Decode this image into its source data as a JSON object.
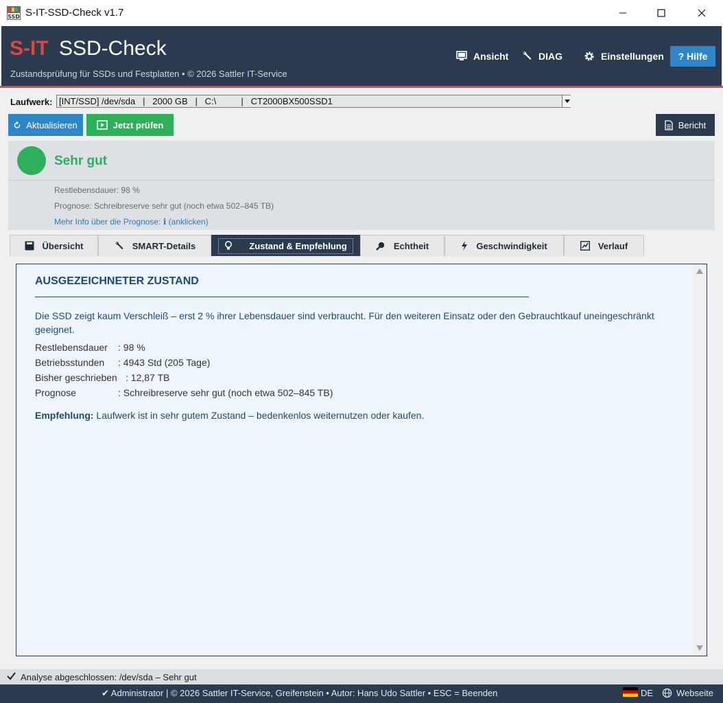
{
  "window": {
    "title": "S-IT-SSD-Check  v1.7"
  },
  "header": {
    "brand_prefix": "S-IT",
    "brand_name": "SSD-Check",
    "subtitle": "Zustandsprüfung für SSDs und Festplatten  •  © 2026 Sattler IT-Service",
    "buttons": {
      "ansicht": "Ansicht",
      "diag": "DIAG",
      "einstellungen": "Einstellungen",
      "hilfe": "? Hilfe"
    }
  },
  "drive": {
    "label": "Laufwerk:",
    "selected": "[INT/SSD] /dev/sda   |   2000 GB   |   C:\\          |   CT2000BX500SSD1"
  },
  "toolbar": {
    "aktualisieren": "Aktualisieren",
    "jetzt_pruefen": "Jetzt prüfen",
    "bericht": "Bericht"
  },
  "status": {
    "label": "Sehr gut",
    "color": "#2eaf5a",
    "restlebensdauer": "Restlebensdauer: 98 %",
    "prognose": "Prognose: Schreibreserve sehr gut  (noch etwa 502–845 TB)",
    "info_link": "Mehr Info über die Prognose:  ℹ  (anklicken)"
  },
  "tabs": [
    {
      "label": "Übersicht",
      "icon": "drive-icon"
    },
    {
      "label": "SMART-Details",
      "icon": "wrench-icon"
    },
    {
      "label": "Zustand & Empfehlung",
      "icon": "lightbulb-icon",
      "active": true
    },
    {
      "label": "Echtheit",
      "icon": "magnifier-icon"
    },
    {
      "label": "Geschwindigkeit",
      "icon": "lightning-icon"
    },
    {
      "label": "Verlauf",
      "icon": "chart-icon"
    }
  ],
  "content": {
    "heading": "AUSGEZEICHNETER ZUSTAND",
    "description": "Die SSD zeigt kaum Verschleiß – erst 2 % ihrer Lebensdauer sind verbraucht. Für den weiteren Einsatz oder den Gebrauchtkauf uneingeschränkt geeignet.",
    "details": [
      {
        "key": "Restlebensdauer",
        "value": ": 98 %"
      },
      {
        "key": "Betriebsstunden",
        "value": ": 4943 Std (205 Tage)"
      },
      {
        "key": "Bisher geschrieben",
        "value": ": 12,87 TB"
      },
      {
        "key": "Prognose",
        "value": ": Schreibreserve sehr gut  (noch etwa 502–845 TB)"
      }
    ],
    "empfehlung_label": "Empfehlung:",
    "empfehlung_text": " Laufwerk ist in sehr gutem Zustand – bedenkenlos weiternutzen oder kaufen."
  },
  "statusbar": {
    "text": "Analyse abgeschlossen: /dev/sda  –  Sehr gut"
  },
  "footer": {
    "text": "✔ Administrator  |  © 2026 Sattler IT-Service, Greifenstein  •  Autor: Hans Udo Sattler  •  ESC = Beenden",
    "language": "DE",
    "website": "Webseite"
  }
}
